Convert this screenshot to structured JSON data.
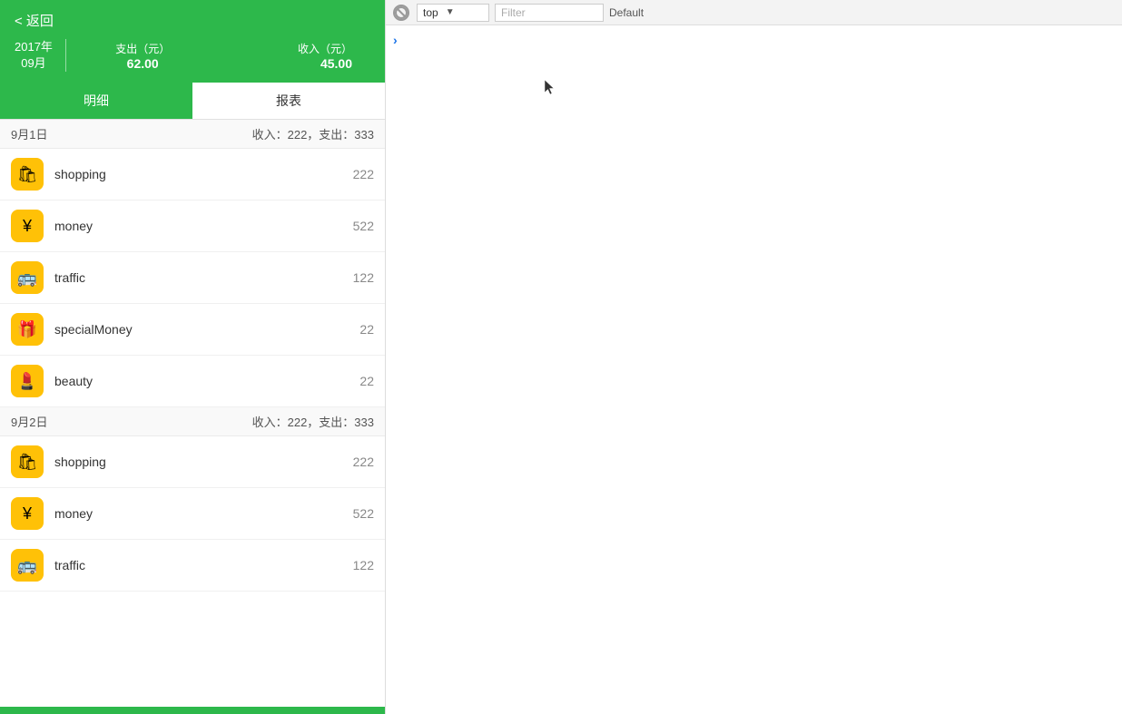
{
  "header": {
    "back_label": "< 返回",
    "year": "2017年",
    "month": "09月",
    "expense_label": "支出（元）",
    "expense_value": "62.00",
    "income_label": "收入（元）",
    "income_value": "45.00"
  },
  "tabs": [
    {
      "id": "detail",
      "label": "明细",
      "active": true
    },
    {
      "id": "report",
      "label": "报表",
      "active": false
    }
  ],
  "groups": [
    {
      "date": "9月1日",
      "summary": "收入：222，支出：333",
      "transactions": [
        {
          "id": "t1",
          "icon": "🛍",
          "label": "shopping",
          "amount": "222"
        },
        {
          "id": "t2",
          "icon": "💰",
          "label": "money",
          "amount": "522"
        },
        {
          "id": "t3",
          "icon": "🚌",
          "label": "traffic",
          "amount": "122"
        },
        {
          "id": "t4",
          "icon": "🎁",
          "label": "specialMoney",
          "amount": "22"
        },
        {
          "id": "t5",
          "icon": "💄",
          "label": "beauty",
          "amount": "22"
        }
      ]
    },
    {
      "date": "9月2日",
      "summary": "收入：222，支出：333",
      "transactions": [
        {
          "id": "t6",
          "icon": "🛍",
          "label": "shopping",
          "amount": "222"
        },
        {
          "id": "t7",
          "icon": "💰",
          "label": "money",
          "amount": "522"
        },
        {
          "id": "t8",
          "icon": "🚌",
          "label": "traffic",
          "amount": "122"
        }
      ]
    }
  ],
  "devtools": {
    "block_icon": "🚫",
    "top_label": "top",
    "filter_placeholder": "Filter",
    "default_label": "Default",
    "arrow_symbol": "›"
  }
}
